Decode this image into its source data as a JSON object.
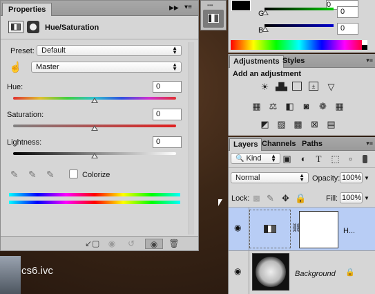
{
  "properties": {
    "tab_label": "Properties",
    "title": "Hue/Saturation",
    "preset_label": "Preset:",
    "preset_value": "Default",
    "channel_value": "Master",
    "hue_label": "Hue:",
    "hue_value": "0",
    "saturation_label": "Saturation:",
    "saturation_value": "0",
    "lightness_label": "Lightness:",
    "lightness_value": "0",
    "colorize_label": "Colorize"
  },
  "color": {
    "g_label": "G",
    "b_label": "B",
    "g_value": "0",
    "b_value": "0",
    "top_value": "0"
  },
  "adjustments": {
    "tab_label": "Adjustments",
    "styles_label": "Styles",
    "heading": "Add an adjustment"
  },
  "layers": {
    "tab_label": "Layers",
    "channels_label": "Channels",
    "paths_label": "Paths",
    "kind_label": "Kind",
    "blend_mode": "Normal",
    "opacity_label": "Opacity:",
    "opacity_value": "100%",
    "lock_label": "Lock:",
    "fill_label": "Fill:",
    "fill_value": "100%",
    "layer1_name": "H...",
    "layer2_name": "Background"
  },
  "canvas": {
    "label": "cs6.ivc"
  }
}
